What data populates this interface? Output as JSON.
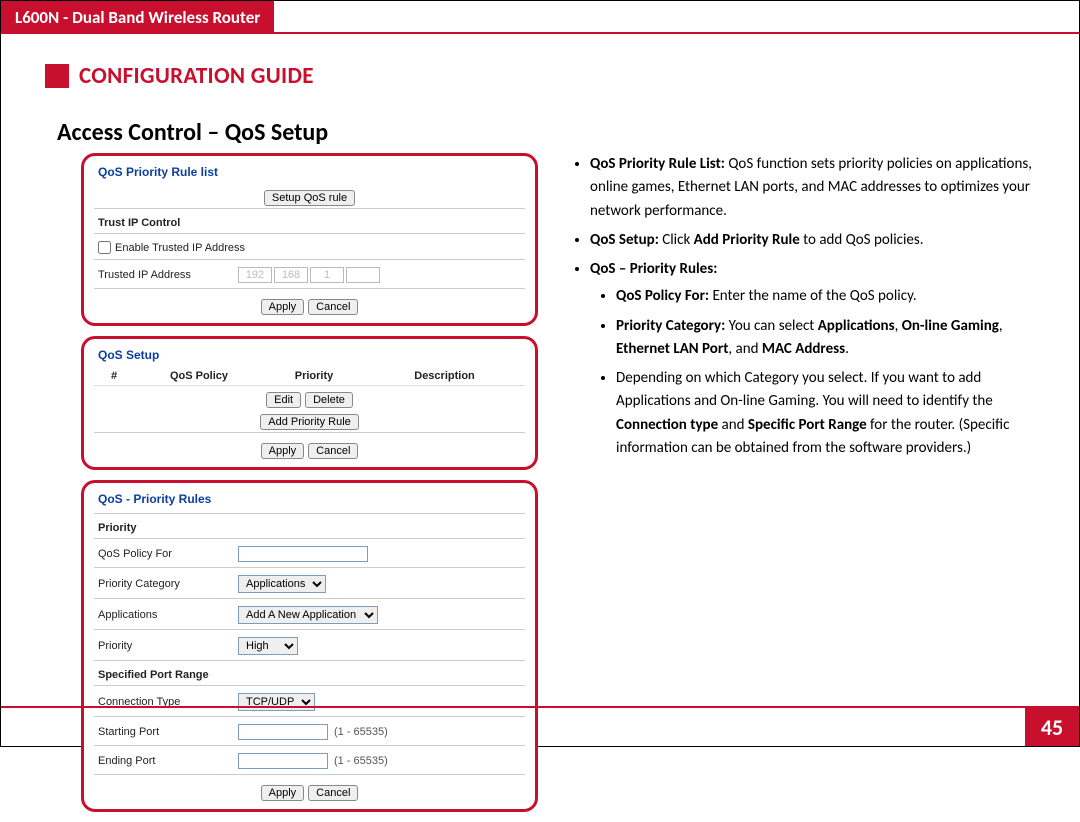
{
  "top_title": "L600N - Dual Band Wireless Router",
  "guide_title": "CONFIGURATION GUIDE",
  "section_title": "Access Control – QoS Setup",
  "page_number": "45",
  "panel1": {
    "title": "QoS Priority Rule list",
    "setup_btn": "Setup QoS rule",
    "trust_hdr": "Trust IP Control",
    "enable_label": "Enable Trusted IP Address",
    "trusted_label": "Trusted IP Address",
    "ip_seg": [
      "192",
      "168",
      "1",
      ""
    ],
    "apply": "Apply",
    "cancel": "Cancel"
  },
  "panel2": {
    "title": "QoS Setup",
    "col_num": "#",
    "col_policy": "QoS Policy",
    "col_priority": "Priority",
    "col_desc": "Description",
    "edit": "Edit",
    "delete": "Delete",
    "add": "Add Priority Rule",
    "apply": "Apply",
    "cancel": "Cancel"
  },
  "panel3": {
    "title": "QoS - Priority Rules",
    "sub_priority": "Priority",
    "policy_for": "QoS Policy For",
    "priority_category": "Priority Category",
    "cat_val": "Applications",
    "applications": "Applications",
    "app_val": "Add A New Application",
    "priority_lbl": "Priority",
    "priority_val": "High",
    "sub_range": "Specified Port Range",
    "conn_type": "Connection Type",
    "conn_val": "TCP/UDP",
    "start_port": "Starting Port",
    "end_port": "Ending Port",
    "port_hint": "(1 - 65535)",
    "apply": "Apply",
    "cancel": "Cancel"
  },
  "desc": {
    "b1a": "QoS Priority Rule List: ",
    "b1b": "QoS function sets priority policies on applications, online games, Ethernet LAN ports, and MAC addresses to optimizes your network performance.",
    "b2a": "QoS Setup: ",
    "b2b": "Click ",
    "b2c": "Add Priority Rule",
    "b2d": " to add QoS policies.",
    "b3": "QoS – Priority Rules:",
    "s1a": "QoS Policy For: ",
    "s1b": "Enter the name of the QoS policy.",
    "s2a": "Priority Category: ",
    "s2b": "You can select ",
    "s2c": "Applications",
    "s2d": ", ",
    "s2e": "On-line Gaming",
    "s2f": ", ",
    "s2g": "Ethernet LAN Port",
    "s2h": ", and ",
    "s2i": "MAC Address",
    "s2j": ".",
    "s3a": "Depending on which Category you select. If you want to add Applications and On-line Gaming. You will need to identify the ",
    "s3b": "Connection type",
    "s3c": " and ",
    "s3d": "Specific Port Range",
    "s3e": " for the router. (Specific information can be obtained from the software providers.)"
  }
}
